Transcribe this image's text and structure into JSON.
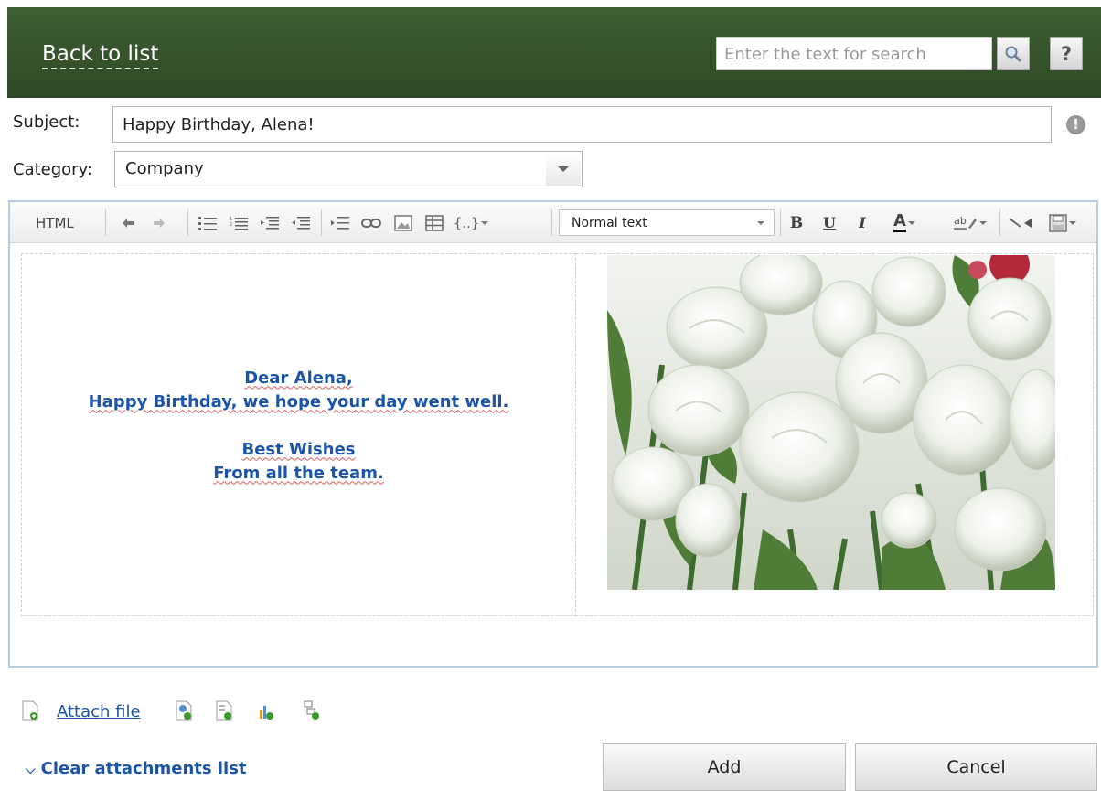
{
  "header": {
    "back_label": "Back to list",
    "search_placeholder": "Enter the text for search",
    "help_label": "?"
  },
  "form": {
    "subject_label": "Subject:",
    "subject_value": "Happy Birthday, Alena!",
    "category_label": "Category:",
    "category_value": "Company",
    "warning_glyph": "!"
  },
  "toolbar": {
    "html_label": "HTML",
    "text_style_value": "Normal text",
    "bold": "B",
    "underline": "U",
    "italic": "I",
    "font_color": "A",
    "highlight": "ab"
  },
  "message": {
    "line1": "Dear Alena,",
    "line2": "Happy Birthday, we hope your day went well.",
    "line3": "Best Wishes",
    "line4": "From all the team."
  },
  "attachments": {
    "attach_label": "Attach file",
    "clear_label": "Clear attachments list"
  },
  "actions": {
    "add_label": "Add",
    "cancel_label": "Cancel"
  },
  "colors": {
    "header_green": "#3e5e33",
    "link_blue": "#1d55a6",
    "editor_border": "#b5cbe4"
  }
}
